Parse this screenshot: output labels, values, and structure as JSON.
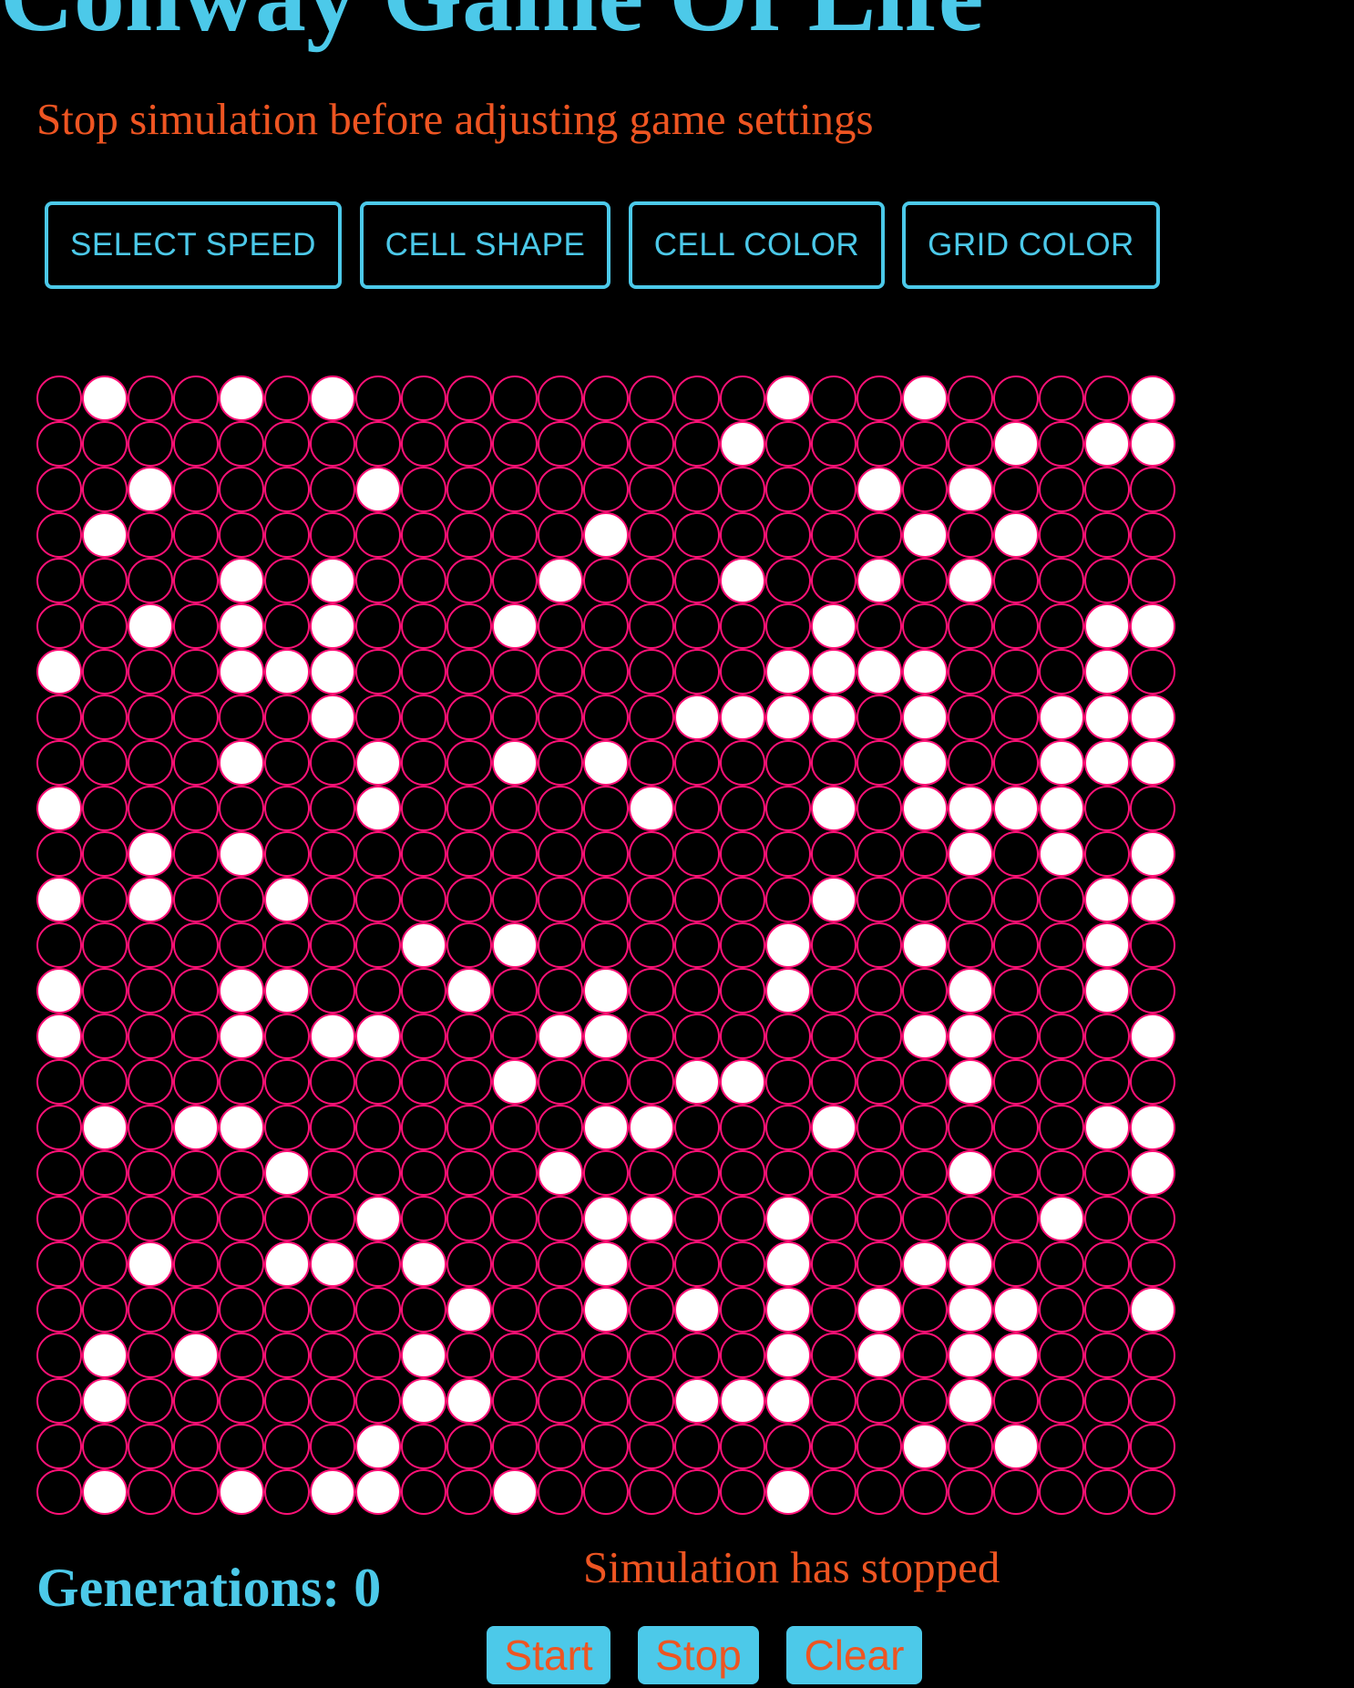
{
  "title": "Conway Game Of Life",
  "warning": "Stop simulation before adjusting game settings",
  "settings": {
    "speed_label": "SELECT SPEED",
    "shape_label": "CELL SHAPE",
    "cell_color_label": "CELL COLOR",
    "grid_color_label": "GRID COLOR"
  },
  "board": {
    "rows": 25,
    "cols": 25,
    "cell_shape": "circle",
    "cell_color": "#ffffff",
    "grid_color": "#ff1177",
    "background": "#000000",
    "live_cells": [
      "0100101000000000100100001",
      "0000000000000001000001011",
      "0010000100000000001010000",
      "0100000000001000000101000",
      "0000101000010001001010000",
      "0010101000100000010000011",
      "1000111000000000111100010",
      "0000001000000011110100111",
      "0000100100101000000100111",
      "1000000100000100010111100",
      "0010100000000000000010101",
      "1010010000000000010000011",
      "0000000010100000100100010",
      "1000110001001000100010010",
      "1000101100011000000110001",
      "0000000000100011000010000",
      "0101100000001100010000011",
      "0000010000010000000010001",
      "0000000100001100100000100",
      "0010011010001000100110000",
      "0000000001001010101011001",
      "0101000010000000101011000",
      "0100000011000011100010000",
      "0000000100000000000101000",
      "0100101100100000100000000"
    ]
  },
  "generations_label": "Generations:",
  "generations": 0,
  "generations_text": "Generations: 0",
  "status": "Simulation has stopped",
  "controls": {
    "start_label": "Start",
    "stop_label": "Stop",
    "clear_label": "Clear"
  },
  "colors": {
    "accent": "#4cc9e9",
    "warning": "#ee5522",
    "background": "#000000"
  }
}
